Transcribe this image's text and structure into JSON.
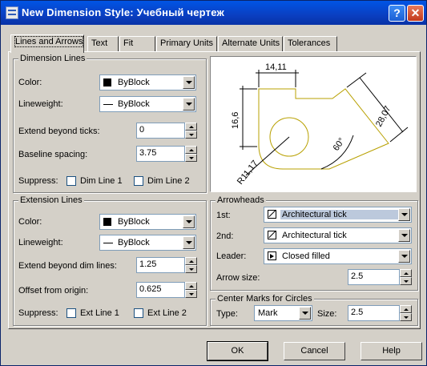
{
  "window": {
    "title": "New Dimension Style: Учебный чертеж"
  },
  "tabs": [
    "Lines and Arrows",
    "Text",
    "Fit",
    "Primary Units",
    "Alternate Units",
    "Tolerances"
  ],
  "dimension_lines": {
    "legend": "Dimension Lines",
    "color_label": "Color:",
    "color_value": "ByBlock",
    "lineweight_label": "Lineweight:",
    "lineweight_value": "ByBlock",
    "extend_label": "Extend beyond ticks:",
    "extend_value": "0",
    "baseline_label": "Baseline spacing:",
    "baseline_value": "3.75",
    "suppress_label": "Suppress:",
    "dim1_label": "Dim Line 1",
    "dim2_label": "Dim Line 2"
  },
  "extension_lines": {
    "legend": "Extension Lines",
    "color_label": "Color:",
    "color_value": "ByBlock",
    "lineweight_label": "Lineweight:",
    "lineweight_value": "ByBlock",
    "extend_label": "Extend beyond dim lines:",
    "extend_value": "1.25",
    "offset_label": "Offset from origin:",
    "offset_value": "0.625",
    "suppress_label": "Suppress:",
    "ext1_label": "Ext Line 1",
    "ext2_label": "Ext Line 2"
  },
  "preview": {
    "dim_top": "14,11",
    "dim_left": "16,6",
    "dim_diag": "28,07",
    "dim_angle": "60°",
    "dim_radius": "R11,17"
  },
  "arrowheads": {
    "legend": "Arrowheads",
    "first_label": "1st:",
    "first_value": "Architectural tick",
    "second_label": "2nd:",
    "second_value": "Architectural tick",
    "leader_label": "Leader:",
    "leader_value": "Closed filled",
    "size_label": "Arrow size:",
    "size_value": "2.5"
  },
  "center_marks": {
    "legend": "Center Marks for Circles",
    "type_label": "Type:",
    "type_value": "Mark",
    "size_label": "Size:",
    "size_value": "2.5"
  },
  "buttons": {
    "ok": "OK",
    "cancel": "Cancel",
    "help": "Help"
  },
  "colors": {
    "title_bar": "#0a3fc1",
    "preview_geometry": "#b8a000",
    "window_face": "#d4d0c8"
  }
}
